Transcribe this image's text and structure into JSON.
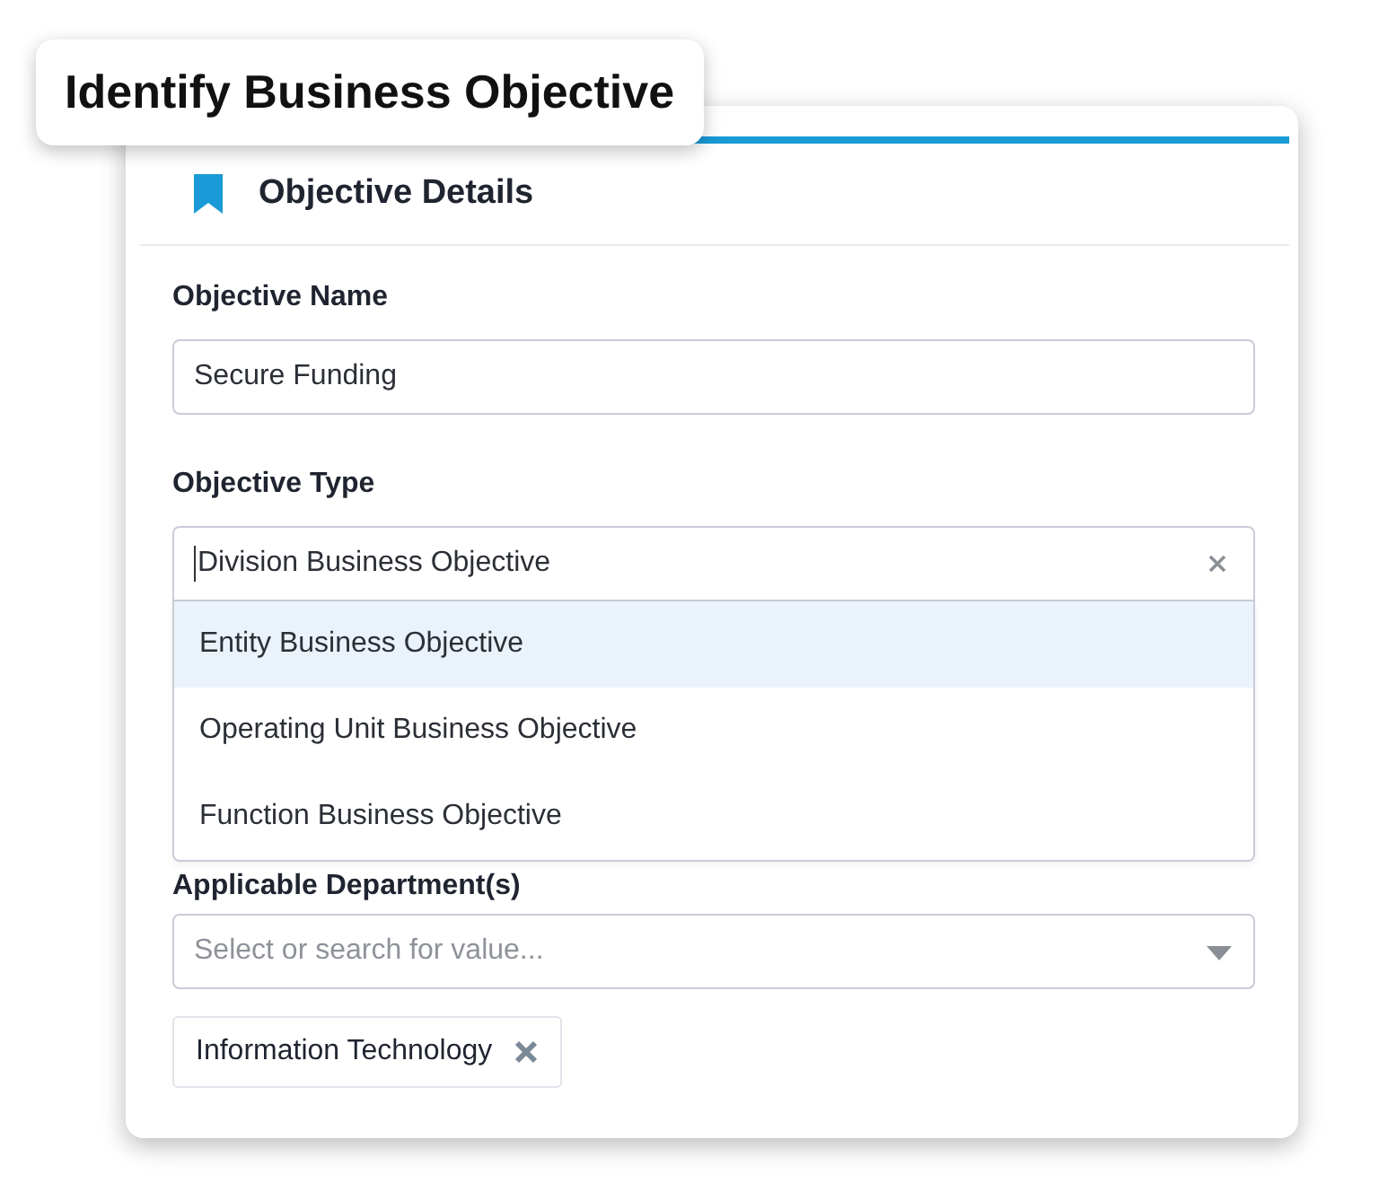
{
  "title_badge": "Identify Business Objective",
  "panel": {
    "title": "Objective Details"
  },
  "fields": [
    {
      "kind": "text",
      "label": "Objective Name",
      "value": "Secure Funding"
    },
    {
      "kind": "combo",
      "label": "Objective Type",
      "value": "Division Business Objective",
      "open": true,
      "options": [
        {
          "label": "Entity Business Objective",
          "selected": true
        },
        {
          "label": "Operating Unit Business Objective",
          "selected": false
        },
        {
          "label": "Function Business Objective",
          "selected": false
        }
      ]
    },
    {
      "kind": "multiselect",
      "label": "Applicable Department(s)",
      "placeholder": "Select or search for value...",
      "tags": [
        "Information Technology"
      ]
    }
  ]
}
